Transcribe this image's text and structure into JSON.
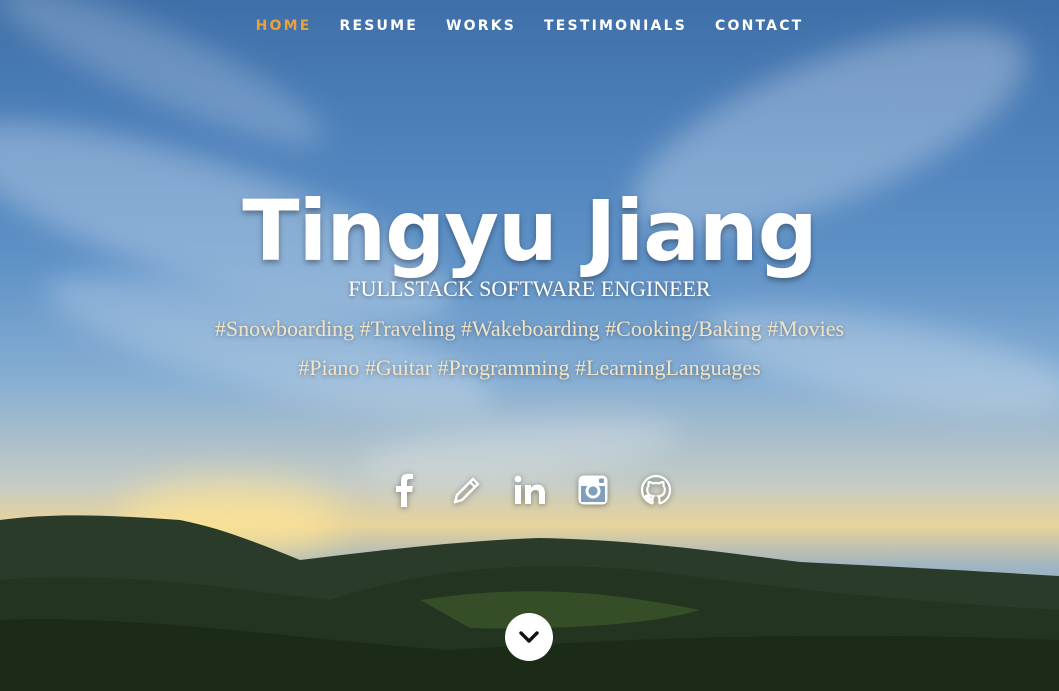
{
  "nav": {
    "items": [
      {
        "label": "HOME",
        "active": true
      },
      {
        "label": "RESUME",
        "active": false
      },
      {
        "label": "WORKS",
        "active": false
      },
      {
        "label": "TESTIMONIALS",
        "active": false
      },
      {
        "label": "CONTACT",
        "active": false
      }
    ],
    "active_color": "#e8a23a"
  },
  "hero": {
    "name": "Tingyu Jiang",
    "role": "FULLSTACK SOFTWARE ENGINEER",
    "hashtags": "#Snowboarding #Traveling #Wakeboarding #Cooking/Baking #Movies #Piano #Guitar #Programming #LearningLanguages"
  },
  "social": {
    "icons": [
      "facebook-icon",
      "pencil-icon",
      "linkedin-icon",
      "instagram-icon",
      "github-icon"
    ]
  },
  "scroll": {
    "icon": "chevron-down-icon"
  }
}
